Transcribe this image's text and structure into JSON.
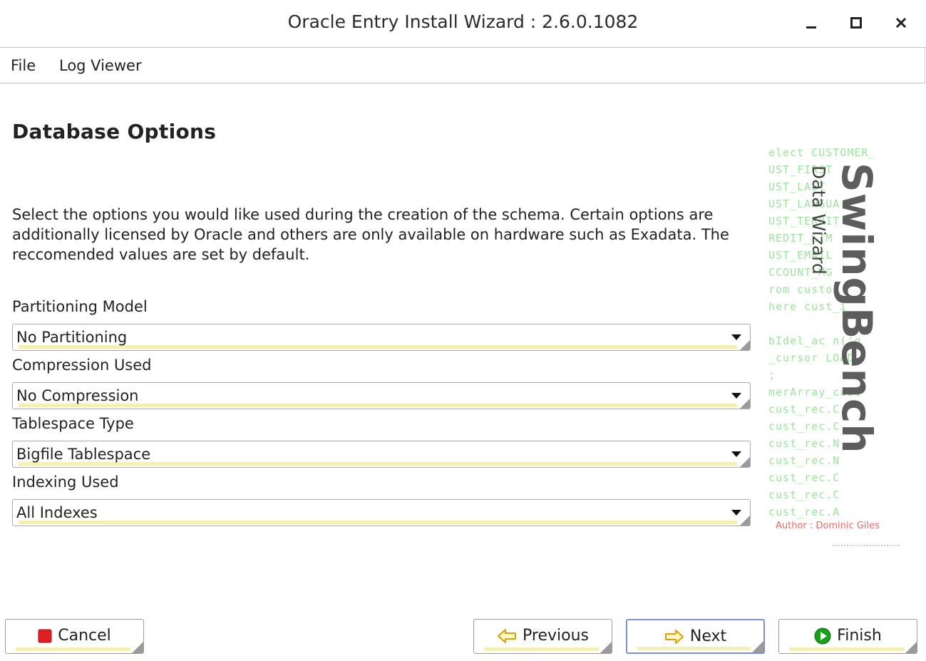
{
  "window": {
    "title": "Oracle Entry Install Wizard : 2.6.0.1082",
    "controls": [
      "minimize-icon",
      "maximize-icon",
      "close-icon"
    ]
  },
  "menu": [
    {
      "label": "File"
    },
    {
      "label": "Log Viewer"
    }
  ],
  "page": {
    "heading": "Database Options",
    "description": "Select the options you would like used during the creation of the schema. Certain options are additionally licensed by Oracle and others are only available on hardware such as Exadata. The reccomended values are set by default."
  },
  "fields": [
    {
      "label": "Partitioning Model",
      "value": "No Partitioning"
    },
    {
      "label": "Compression Used",
      "value": "No Compression"
    },
    {
      "label": "Tablespace Type",
      "value": "Bigfile Tablespace"
    },
    {
      "label": "Indexing Used",
      "value": "All Indexes"
    }
  ],
  "buttons": {
    "cancel": {
      "label": "Cancel",
      "icon": "stop-icon",
      "icon_color": "#e02020"
    },
    "previous": {
      "label": "Previous",
      "icon": "arrow-left-icon",
      "icon_color": "#f0b400"
    },
    "next": {
      "label": "Next",
      "icon": "arrow-right-icon",
      "icon_color": "#f0b400"
    },
    "finish": {
      "label": "Finish",
      "icon": "play-circle-icon",
      "icon_color": "#18a018"
    }
  },
  "logo": {
    "brand": "SwingBench",
    "subtitle": "Data Wizard",
    "author": "Author : Dominic Giles",
    "code_lines": [
      "elect CUSTOMER_",
      "  UST_FIRST",
      "  UST_LAST",
      "  UST_LANGUA",
      "  UST_TERRIT",
      "  REDIT_LIM",
      "  UST_EMAIL",
      "  CCOUNT_MG",
      "rom custo",
      "here cust_i",
      "",
      "bIdel_ac  n('g",
      "_cursor LOAD",
      ";",
      "merArray_cust",
      "   cust_rec.C",
      "   cust_rec.C",
      "   cust_rec.N",
      "   cust_rec.N",
      "   cust_rec.C",
      "   cust_rec.C",
      "   cust_rec.A"
    ]
  }
}
